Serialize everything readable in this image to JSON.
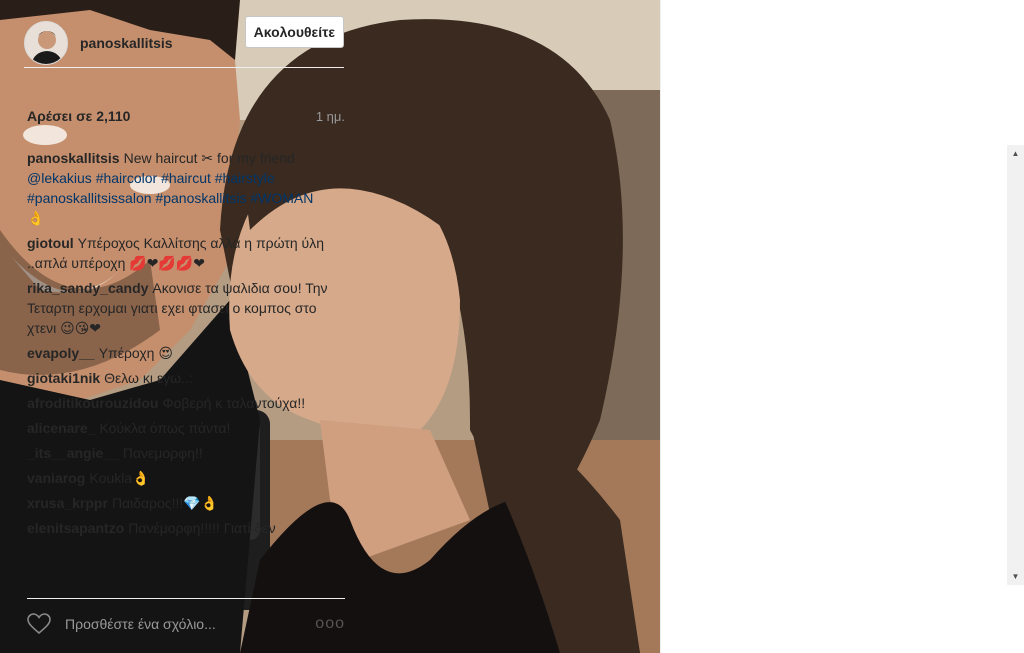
{
  "post": {
    "username": "panoskallitsis",
    "follow_label": "Ακολουθείτε",
    "likes": "Αρέσει σε 2,110",
    "time": "1 ημ."
  },
  "comments": [
    {
      "user": "panoskallitsis",
      "parts": [
        {
          "text": "New haircut ✂ for my friend "
        },
        {
          "text": "@lekakius",
          "link": true
        },
        {
          "text": " "
        },
        {
          "text": "#haircolor",
          "link": true
        },
        {
          "text": " "
        },
        {
          "text": "#haircut",
          "link": true
        },
        {
          "text": " "
        },
        {
          "text": "#hairstyle",
          "link": true
        },
        {
          "text": " "
        },
        {
          "text": "#panoskallitsissalon",
          "link": true
        },
        {
          "text": " "
        },
        {
          "text": "#panoskallitsis",
          "link": true
        },
        {
          "text": " "
        },
        {
          "text": "#WOMAN",
          "link": true
        },
        {
          "text": " 👌"
        }
      ]
    },
    {
      "user": "giotoul",
      "parts": [
        {
          "text": "Υπέροχος Καλλίτσης αλλά η πρώτη ύλη ..απλά υπέροχη 💋❤💋💋❤"
        }
      ]
    },
    {
      "user": "rika_sandy_candy",
      "parts": [
        {
          "text": "Ακονισε τα ψαλιδια σου! Την Τεταρτη ερχομαι γιατι εχει φτασει ο κομπος στο χτενι 😉😘❤"
        }
      ]
    },
    {
      "user": "evapoly__",
      "parts": [
        {
          "text": "Υπέροχη 😍"
        }
      ]
    },
    {
      "user": "giotaki1nik",
      "parts": [
        {
          "text": "Θελω κι εγω..:"
        }
      ]
    },
    {
      "user": "afroditikourouzidou",
      "parts": [
        {
          "text": "Φοβερή κ ταλαντούχα!!"
        }
      ]
    },
    {
      "user": "alicenare_",
      "parts": [
        {
          "text": "Κούκλα όπως πάντα!"
        }
      ]
    },
    {
      "user": "_its__angie__",
      "parts": [
        {
          "text": "Πανεμορφη!!"
        }
      ]
    },
    {
      "user": "vaniarog",
      "parts": [
        {
          "text": "Koukla👌"
        }
      ]
    },
    {
      "user": "xrusa_krppr",
      "parts": [
        {
          "text": "Παιδαρος!!!💎👌"
        }
      ]
    },
    {
      "user": "elenitsapantzo",
      "parts": [
        {
          "text": "Πανέμορφη!!!!! Γιατί δεν"
        }
      ]
    }
  ],
  "comment_box": {
    "placeholder": "Προσθέστε ένα σχόλιο...",
    "more": "ooo"
  },
  "icons": {
    "like": "heart-icon",
    "more": "more-options-icon",
    "scroll_up": "scroll-up-arrow",
    "scroll_down": "scroll-down-arrow"
  },
  "colors": {
    "link": "#003569",
    "text": "#262626",
    "muted": "#999999"
  }
}
